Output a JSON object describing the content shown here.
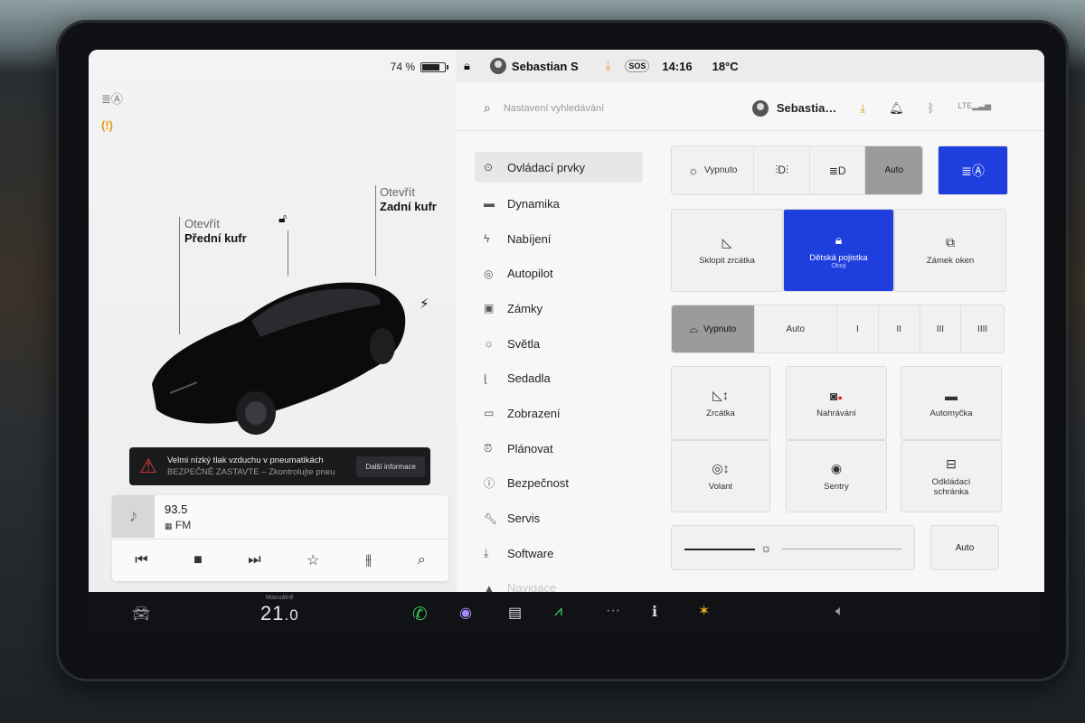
{
  "left": {
    "battery_percent_label": "74 %",
    "battery_level": 0.74,
    "front_trunk": {
      "top": "Otevřít",
      "bottom": "Přední kufr"
    },
    "rear_trunk": {
      "top": "Otevřít",
      "bottom": "Zadní kufr"
    },
    "alert": {
      "title": "Velmi nízký tlak vzduchu v pneumatikách",
      "subtitle": "BEZPEČNĚ ZASTAVTE – Zkontrolujte pneu",
      "button": "Další informace"
    },
    "media": {
      "station": "93.5",
      "band": "FM"
    }
  },
  "topbar": {
    "user": "Sebastian S",
    "sos": "SOS",
    "time": "14:16",
    "temp": "18°C"
  },
  "search": {
    "placeholder": "Nastavení vyhledávání",
    "user_short": "Sebastia…"
  },
  "menu": [
    {
      "label": "Ovládací prvky",
      "icon": "toggle-icon"
    },
    {
      "label": "Dynamika",
      "icon": "car-icon"
    },
    {
      "label": "Nabíjení",
      "icon": "bolt-icon"
    },
    {
      "label": "Autopilot",
      "icon": "steering-icon"
    },
    {
      "label": "Zámky",
      "icon": "lock-icon"
    },
    {
      "label": "Světla",
      "icon": "sun-icon"
    },
    {
      "label": "Sedadla",
      "icon": "seat-icon"
    },
    {
      "label": "Zobrazení",
      "icon": "display-icon"
    },
    {
      "label": "Plánovat",
      "icon": "clock-icon"
    },
    {
      "label": "Bezpečnost",
      "icon": "info-icon"
    },
    {
      "label": "Servis",
      "icon": "wrench-icon"
    },
    {
      "label": "Software",
      "icon": "download-icon"
    },
    {
      "label": "Navigace",
      "icon": "nav-icon"
    }
  ],
  "lights": {
    "off": "Vypnuto",
    "auto": "Auto"
  },
  "tiles_row1": {
    "mirrors": "Sklopit zrcátka",
    "child_lock": "Dětská pojistka",
    "child_lock_sub": "Oboji",
    "window_lock": "Zámek oken"
  },
  "wipers": {
    "off": "Vypnuto",
    "auto": "Auto",
    "s1": "I",
    "s2": "II",
    "s3": "III",
    "s4": "IIII"
  },
  "tiles_grid": {
    "mirrors": "Zrcátka",
    "recording": "Nahrávání",
    "carwash": "Automyčka",
    "wheel": "Volant",
    "sentry": "Sentry",
    "glovebox": "Odkládací schránka"
  },
  "brightness": {
    "auto": "Auto",
    "level": 0.3
  },
  "dock": {
    "climate_mode": "Manuálně",
    "temp_int": "21",
    "temp_dec": ".0"
  }
}
